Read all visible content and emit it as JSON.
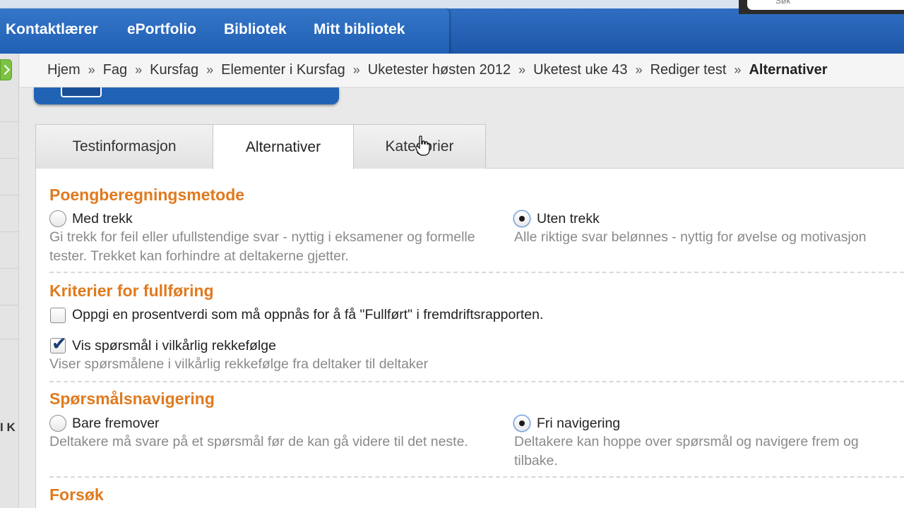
{
  "top_nav": {
    "items": [
      "Kontaktlærer",
      "ePortfolio",
      "Bibliotek",
      "Mitt bibliotek"
    ],
    "search_placeholder": "Søk"
  },
  "sidebar": {
    "letters": "I K"
  },
  "breadcrumb": {
    "items": [
      "Hjem",
      "Fag",
      "Kursfag",
      "Elementer i Kursfag",
      "Uketester høsten 2012",
      "Uketest uke 43",
      "Rediger test"
    ],
    "current": "Alternativer",
    "separator": "»"
  },
  "page": {
    "heading": "Rediger test"
  },
  "tabs": [
    {
      "label": "Testinformasjon",
      "active": false
    },
    {
      "label": "Alternativer",
      "active": true
    },
    {
      "label": "Kategorier",
      "active": false
    }
  ],
  "sections": {
    "scoring": {
      "title": "Poengberegningsmetode",
      "option_a": {
        "label": "Med trekk",
        "checked": false,
        "desc": "Gi trekk for feil eller ufullstendige svar - nyttig i eksamener og formelle tester. Trekket kan forhindre at deltakerne gjetter."
      },
      "option_b": {
        "label": "Uten trekk",
        "checked": true,
        "desc": "Alle riktige svar belønnes - nyttig for øvelse og motivasjon"
      }
    },
    "completion": {
      "title": "Kriterier for fullføring",
      "percent_label": "Oppgi en prosentverdi som må oppnås for å få \"Fullført\" i fremdriftsrapporten.",
      "percent_checked": false,
      "random_label": "Vis spørsmål i vilkårlig rekkefølge",
      "random_checked": true,
      "random_desc": "Viser spørsmålene i vilkårlig rekkefølge fra deltaker til deltaker"
    },
    "navigation": {
      "title": "Spørsmålsnavigering",
      "option_a": {
        "label": "Bare fremover",
        "checked": false,
        "desc": "Deltakere må svare på et spørsmål før de kan gå videre til det neste."
      },
      "option_b": {
        "label": "Fri navigering",
        "checked": true,
        "desc": "Deltakere kan hoppe over spørsmål og navigere frem og tilbake."
      }
    },
    "attempts": {
      "title": "Forsøk"
    }
  },
  "colors": {
    "nav_blue": "#2160b4",
    "section_orange": "#e07a1e",
    "back_green": "#7cc243"
  }
}
